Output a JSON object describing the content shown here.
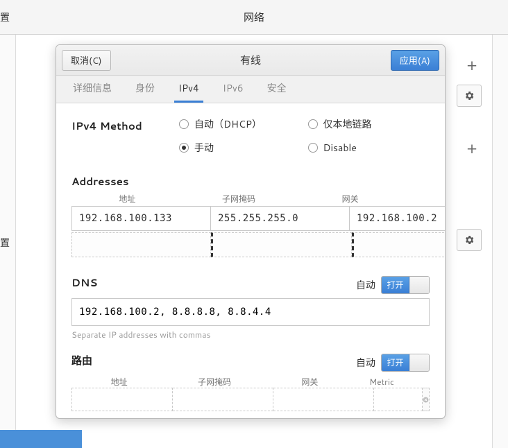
{
  "bg": {
    "title": "网络",
    "settings_left": "置",
    "settings_left2": "置"
  },
  "dialog": {
    "cancel": "取消(C)",
    "title": "有线",
    "apply": "应用(A)",
    "tabs": {
      "details": "详细信息",
      "identity": "身份",
      "ipv4": "IPv4",
      "ipv6": "IPv6",
      "security": "安全"
    },
    "ipv4": {
      "method_label": "IPv4 Method",
      "methods": {
        "auto": "自动（DHCP）",
        "link_local": "仅本地链路",
        "manual": "手动",
        "disable": "Disable"
      },
      "addresses_title": "Addresses",
      "addr_headers": {
        "addr": "地址",
        "mask": "子网掩码",
        "gw": "网关"
      },
      "rows": [
        {
          "addr": "192.168.100.133",
          "mask": "255.255.255.0",
          "gw": "192.168.100.2"
        }
      ],
      "dns_title": "DNS",
      "auto_label": "自动",
      "switch_on": "打开",
      "dns_value": "192.168.100.2, 8.8.8.8, 8.8.4.4",
      "dns_hint": "Separate IP addresses with commas",
      "routes_title": "路由",
      "routes_headers": {
        "addr": "地址",
        "mask": "子网掩码",
        "gw": "网关",
        "metric": "Metric"
      }
    }
  }
}
